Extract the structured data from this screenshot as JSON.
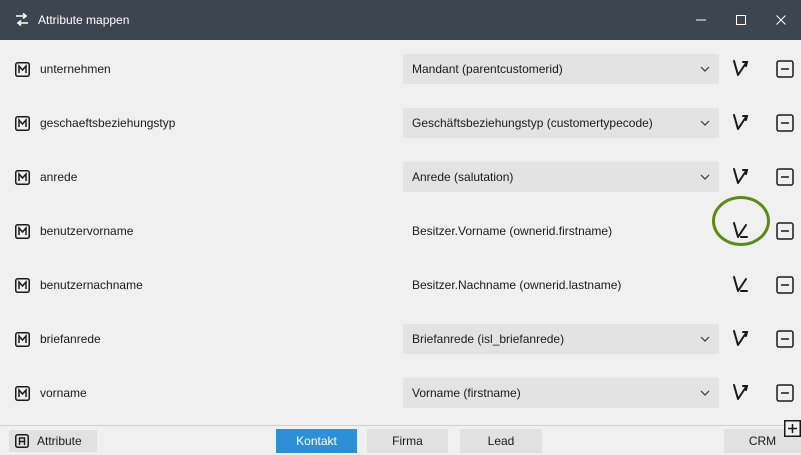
{
  "window": {
    "title": "Attribute mappen",
    "controls": {
      "minimize": "–",
      "maximize": "☐",
      "close": "✕"
    }
  },
  "rows": [
    {
      "name": "unternehmen",
      "value": "Mandant (parentcustomerid)",
      "kind": "dropdown"
    },
    {
      "name": "geschaeftsbeziehungstyp",
      "value": "Geschäftsbeziehungstyp (customertypecode)",
      "kind": "dropdown"
    },
    {
      "name": "anrede",
      "value": "Anrede (salutation)",
      "kind": "dropdown"
    },
    {
      "name": "benutzervorname",
      "value": "Besitzer.Vorname (ownerid.firstname)",
      "kind": "static"
    },
    {
      "name": "benutzernachname",
      "value": "Besitzer.Nachname (ownerid.lastname)",
      "kind": "static"
    },
    {
      "name": "briefanrede",
      "value": "Briefanrede (isl_briefanrede)",
      "kind": "dropdown"
    },
    {
      "name": "vorname",
      "value": "Vorname (firstname)",
      "kind": "dropdown"
    }
  ],
  "bottom": {
    "attribute_tab": "Attribute",
    "tabs": [
      "Kontakt",
      "Firma",
      "Lead",
      "CRM"
    ],
    "active_tab": "Kontakt"
  },
  "colors": {
    "titlebar": "#3d4550",
    "accent": "#2d8fd5",
    "highlight": "#5a8a1a"
  }
}
